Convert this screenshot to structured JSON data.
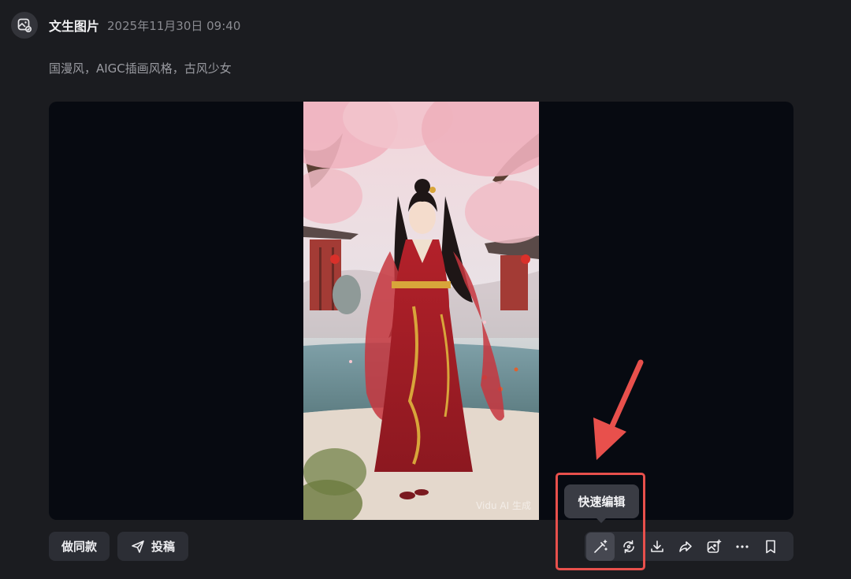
{
  "header": {
    "icon": "image-edit-icon",
    "title": "文生图片",
    "time": "2025年11月30日 09:40"
  },
  "prompt": "国漫风，AIGC插画风格，古风少女",
  "image": {
    "watermark": "Vidu AI 生成"
  },
  "actions": {
    "same_label": "做同款",
    "submit_label": "投稿",
    "submit_icon": "send-icon"
  },
  "toolbar": {
    "items": [
      "magic-edit-icon",
      "refresh-icon",
      "download-icon",
      "share-icon",
      "image-add-icon",
      "more-icon",
      "bookmark-icon"
    ],
    "tooltip": "快速编辑"
  },
  "colors": {
    "background": "#1b1c20",
    "stage": "#070a11",
    "highlight": "#e8504c",
    "button": "#2c2e35"
  }
}
